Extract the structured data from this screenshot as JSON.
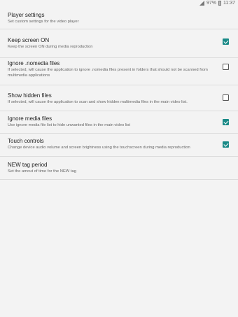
{
  "status": {
    "battery": "97%",
    "time": "11:37"
  },
  "header": {
    "title": "Player settings",
    "summary": "Set custom settings for the video player"
  },
  "settings": [
    {
      "title": "Keep screen ON",
      "summary": "Keep the screen ON during media reproduction",
      "checked": true
    },
    {
      "title": "Ignore .nomedia files",
      "summary": "If selected, will cause the application to ignore .nomedia files present in folders that should not be scanned from multimedia applications",
      "checked": false
    },
    {
      "title": "Show hidden files",
      "summary": "If selected, will cause the application to scan and show hidden multimedia files in the main video list.",
      "checked": false
    },
    {
      "title": "Ignore media files",
      "summary": "Use ignore media file list to hide unwanted files in the main video list",
      "checked": true
    },
    {
      "title": "Touch controls",
      "summary": "Change device audio volume and screen brightness using the touchscreen during media reproduction",
      "checked": true
    },
    {
      "title": "NEW tag period",
      "summary": "Set the amout of time for the NEW tag"
    }
  ]
}
